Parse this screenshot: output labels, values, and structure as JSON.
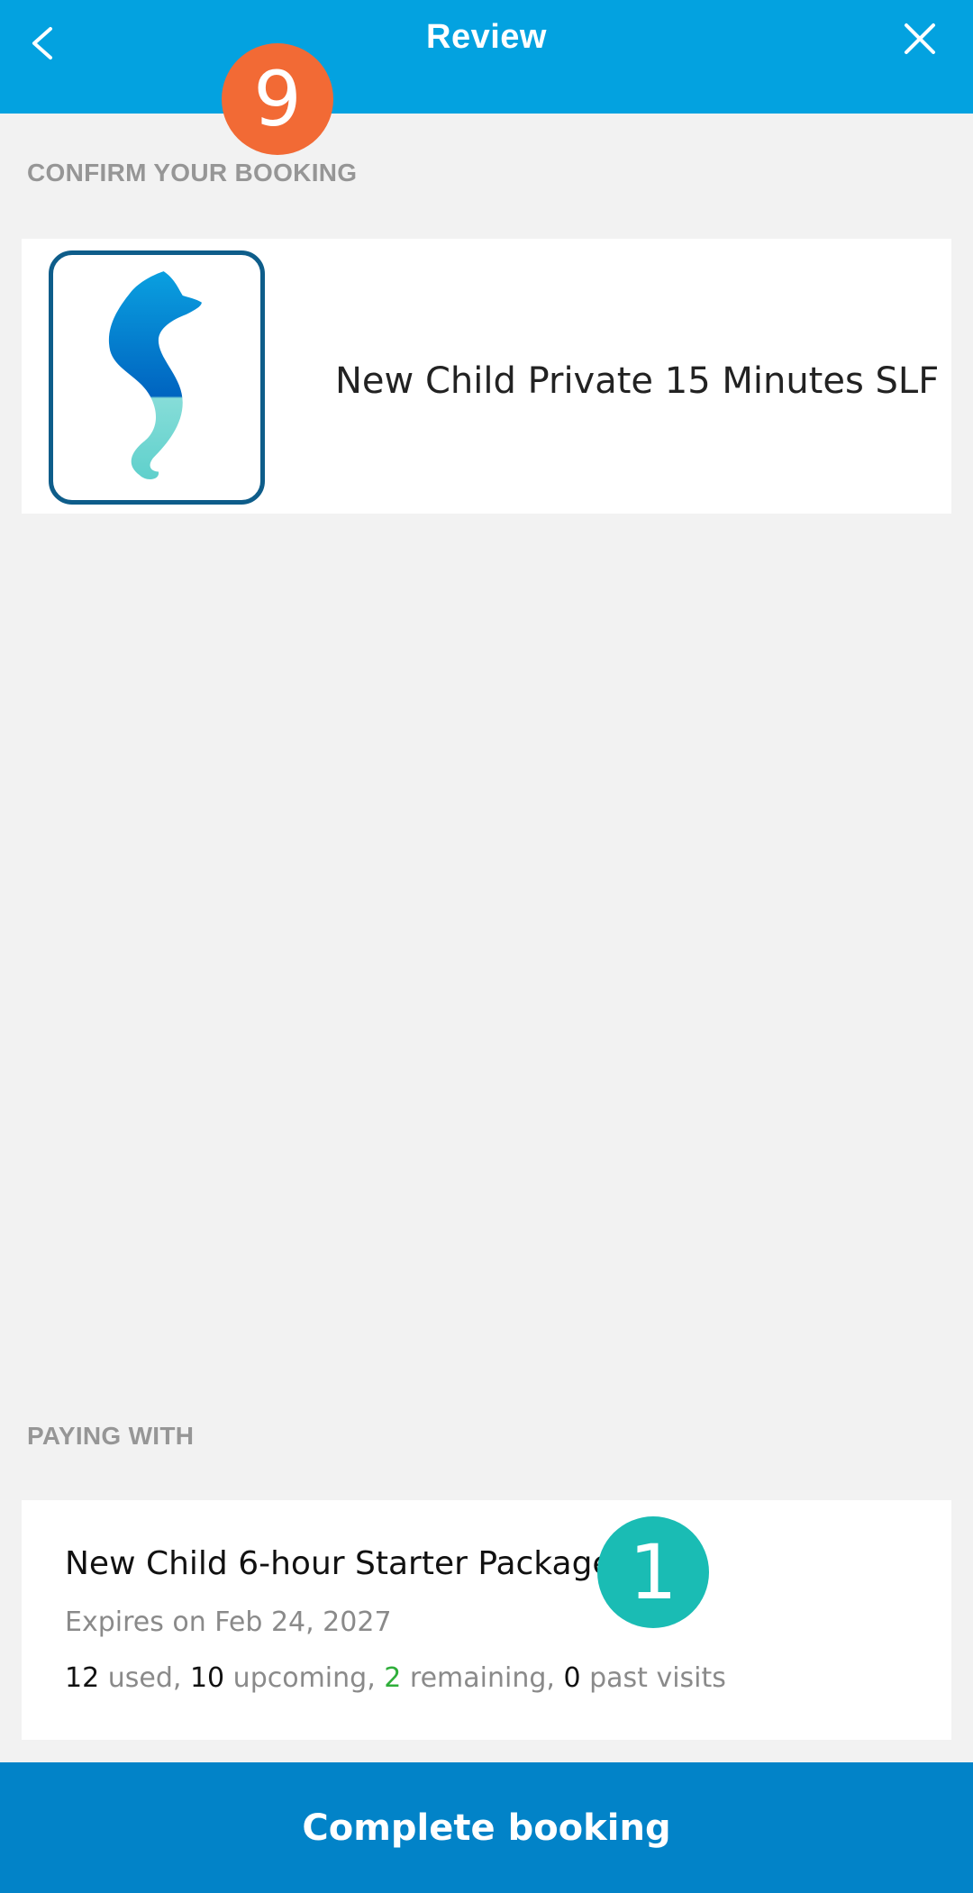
{
  "header": {
    "title": "Review",
    "back_icon": "chevron-left-icon",
    "close_icon": "close-icon",
    "color": "#03a2e0"
  },
  "badges": {
    "top": "9",
    "bottom": "1",
    "top_color": "#f26a35",
    "bottom_color": "#1abcb4"
  },
  "confirm": {
    "section_label": "CONFIRM YOUR BOOKING",
    "service_name": "New Child Private 15 Minutes SLF",
    "logo_icon": "seahorse-logo"
  },
  "payment": {
    "section_label": "PAYING WITH",
    "package_name": "New Child 6-hour Starter Package",
    "expiry": "Expires on Feb 24, 2027",
    "usage": {
      "used_count": "12",
      "used_label": " used, ",
      "upcoming_count": "10",
      "upcoming_label": " upcoming, ",
      "remaining_count": "2",
      "remaining_label": " remaining, ",
      "past_count": "0",
      "past_label": " past visits"
    }
  },
  "footer": {
    "cta_label": "Complete booking",
    "color": "#0283c8"
  }
}
